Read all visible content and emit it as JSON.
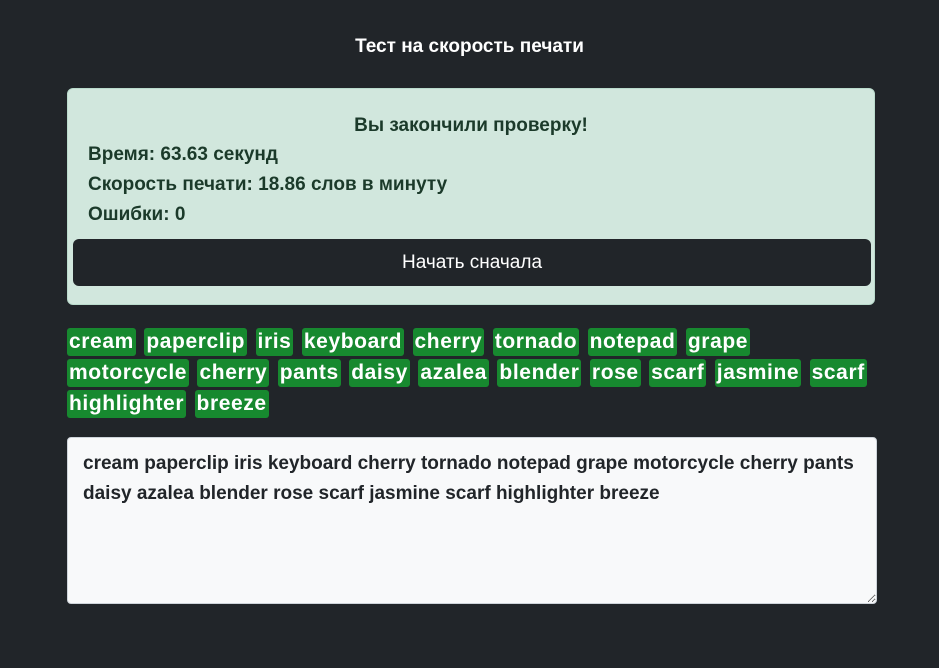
{
  "header": {
    "title": "Тест на скорость печати"
  },
  "result": {
    "heading": "Вы закончили проверку!",
    "time_line": "Время: 63.63 секунд",
    "speed_line": "Скорость печати: 18.86 слов в минуту",
    "errors_line": "Ошибки: 0",
    "restart_label": "Начать сначала"
  },
  "words": [
    "cream",
    "paperclip",
    "iris",
    "keyboard",
    "cherry",
    "tornado",
    "notepad",
    "grape",
    "motorcycle",
    "cherry",
    "pants",
    "daisy",
    "azalea",
    "blender",
    "rose",
    "scarf",
    "jasmine",
    "scarf",
    "highlighter",
    "breeze"
  ],
  "input": {
    "value": "cream paperclip iris keyboard cherry tornado notepad grape motorcycle cherry pants daisy azalea blender rose scarf jasmine scarf highlighter breeze"
  },
  "colors": {
    "background": "#212529",
    "result_bg": "#d1e7dd",
    "correct_word": "#17892f",
    "button_bg": "#212529",
    "input_bg": "#f8f9fa"
  }
}
